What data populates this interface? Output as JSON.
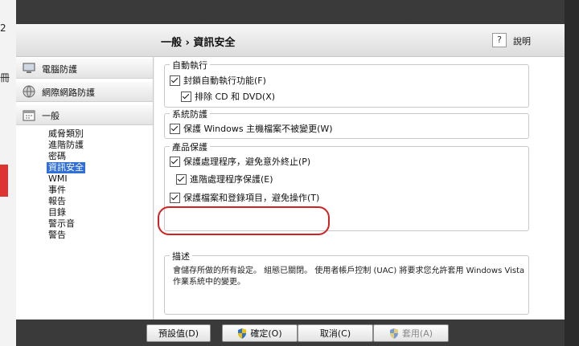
{
  "header": {
    "title": "一般 › 資訊安全",
    "help_symbol": "?",
    "help_label": "說明"
  },
  "nav": {
    "items": [
      {
        "label": "電腦防護",
        "icon": "computer-icon"
      },
      {
        "label": "網際網路防護",
        "icon": "globe-icon"
      },
      {
        "label": "一般",
        "icon": "calendar-icon"
      }
    ],
    "subitems": [
      "威脅類別",
      "進階防護",
      "密碼",
      "資訊安全",
      "WMI",
      "事件",
      "報告",
      "目錄",
      "警示音",
      "警告"
    ],
    "selected": "資訊安全"
  },
  "groups": {
    "autorun": {
      "title": "自動執行",
      "block_autorun": "封鎖自動執行功能(F)",
      "exclude_cd": "排除 CD 和 DVD(X)"
    },
    "system": {
      "title": "系統防護",
      "protect_hosts": "保護 Windows 主機檔案不被變更(W)"
    },
    "product": {
      "title": "產品保護",
      "protect_process": "保護處理程序，避免意外終止(P)",
      "advanced_process": "進階處理程序保護(E)",
      "protect_files": "保護檔案和登錄項目，避免操作(T)"
    },
    "description": {
      "title": "描述",
      "text": "會儲存所做的所有設定。 組態已關閉。 使用者帳戶控制 (UAC) 將要求您允許套用 Windows Vista 作業系統中的變更。"
    }
  },
  "buttons": {
    "defaults": "預設值(D)",
    "ok": "確定(O)",
    "cancel": "取消(C)",
    "apply": "套用(A)"
  },
  "colors": {
    "selection": "#2f6fd6",
    "highlight_circle": "#d42020"
  }
}
